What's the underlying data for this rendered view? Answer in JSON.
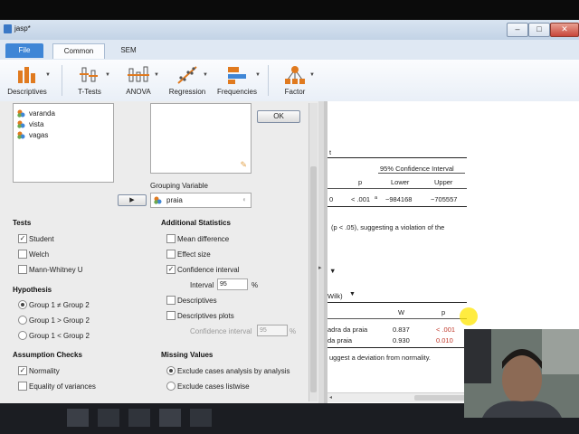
{
  "window": {
    "title": "jasp*"
  },
  "ribbon_tabs": [
    "File",
    "Common",
    "SEM"
  ],
  "toolbar": {
    "descriptives": "Descriptives",
    "ttests": "T-Tests",
    "anova": "ANOVA",
    "regression": "Regression",
    "frequencies": "Frequencies",
    "factor": "Factor"
  },
  "variables": [
    "varanda",
    "vista",
    "vagas"
  ],
  "ok_label": "OK",
  "grouping": {
    "label": "Grouping Variable",
    "value": "praia"
  },
  "tests": {
    "header": "Tests",
    "student": "Student",
    "welch": "Welch",
    "mann_whitney": "Mann-Whitney U"
  },
  "additional": {
    "header": "Additional Statistics",
    "mean_diff": "Mean difference",
    "effect_size": "Effect size",
    "conf_interval": "Confidence interval",
    "interval_label": "Interval",
    "interval_value": "95",
    "percent": "%",
    "descriptives": "Descriptives",
    "descriptives_plots": "Descriptives plots",
    "ci_label": "Confidence interval",
    "ci_value": "95"
  },
  "hypothesis": {
    "header": "Hypothesis",
    "h1": "Group 1 ≠ Group 2",
    "h2": "Group 1 > Group 2",
    "h3": "Group 1 < Group 2"
  },
  "assumptions": {
    "header": "Assumption Checks",
    "normality": "Normality",
    "equality": "Equality of variances"
  },
  "missing": {
    "header": "Missing Values",
    "opt1": "Exclude cases analysis by analysis",
    "opt2": "Exclude cases listwise"
  },
  "results": {
    "t_mark": "t",
    "ci_header": "95% Confidence Interval",
    "col_p": "p",
    "col_lower": "Lower",
    "col_upper": "Upper",
    "row_zero": "0",
    "row_p": "< .001",
    "row_p_mark": "a",
    "row_lower": "−984168",
    "row_upper": "−705557",
    "note1": "(p < .05), suggesting a violation of the",
    "arrow": "▼",
    "wilk": "Wilk)",
    "col_w": "W",
    "col_p2": "p",
    "row1_label": "adra da praia",
    "row1_w": "0.837",
    "row1_p": "< .001",
    "row2_label": "da praia",
    "row2_w": "0.930",
    "row2_p": "0.010",
    "note2": "uggest a deviation from normality."
  },
  "colors": {
    "accent": "#3f86d6",
    "significant": "#c0392b"
  }
}
